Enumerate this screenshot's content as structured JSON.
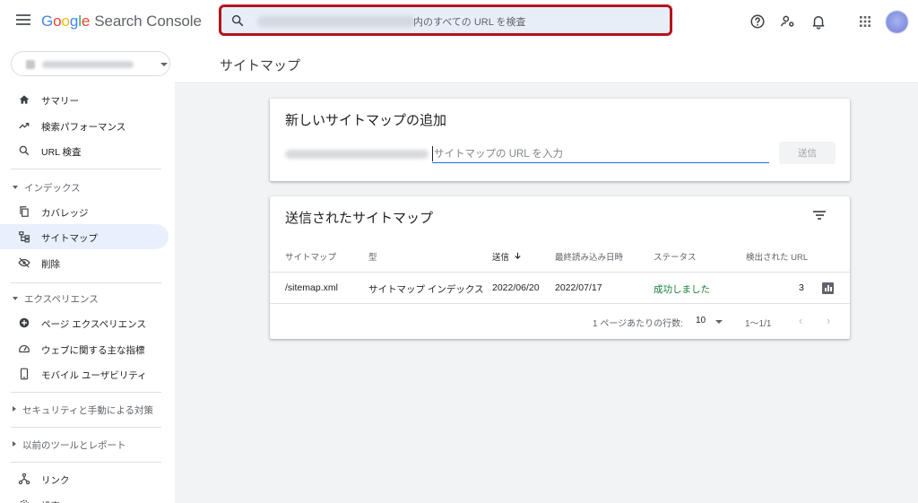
{
  "header": {
    "product_google": [
      "G",
      "o",
      "o",
      "g",
      "l",
      "e"
    ],
    "product_name": "Search Console",
    "search_placeholder": "内のすべての URL を検査"
  },
  "sidebar": {
    "items_top": [
      {
        "label": "サマリー",
        "icon": "home-icon"
      },
      {
        "label": "検索パフォーマンス",
        "icon": "trending-up-icon"
      },
      {
        "label": "URL 検査",
        "icon": "search-icon"
      }
    ],
    "index_section": "インデックス",
    "index_items": [
      {
        "label": "カバレッジ",
        "icon": "file-copy-icon"
      },
      {
        "label": "サイトマップ",
        "icon": "sitemap-icon"
      },
      {
        "label": "削除",
        "icon": "visibility-off-icon"
      }
    ],
    "experience_section": "エクスペリエンス",
    "experience_items": [
      {
        "label": "ページ エクスペリエンス",
        "icon": "add-circle-icon"
      },
      {
        "label": "ウェブに関する主な指標",
        "icon": "speed-icon"
      },
      {
        "label": "モバイル ユーザビリティ",
        "icon": "smartphone-icon"
      }
    ],
    "security_section": "セキュリティと手動による対策",
    "legacy_section": "以前のツールとレポート",
    "bottom_items": [
      {
        "label": "リンク",
        "icon": "links-icon"
      },
      {
        "label": "設定",
        "icon": "settings-icon"
      }
    ]
  },
  "page": {
    "title": "サイトマップ"
  },
  "add_sitemap": {
    "title": "新しいサイトマップの追加",
    "input_placeholder": "サイトマップの URL を入力",
    "submit_label": "送信"
  },
  "submitted": {
    "title": "送信されたサイトマップ",
    "columns": [
      "サイトマップ",
      "型",
      "送信",
      "最終読み込み日時",
      "ステータス",
      "検出された URL"
    ],
    "rows": [
      {
        "sitemap": "/sitemap.xml",
        "type": "サイトマップ インデックス",
        "submitted": "2022/06/20",
        "last_read": "2022/07/17",
        "status": "成功しました",
        "urls": "3"
      }
    ],
    "rows_per_page_label": "1 ページあたりの行数:",
    "rows_per_page_value": "10",
    "range": "1〜1/1"
  },
  "colors": {
    "accent": "#1a73e8",
    "highlight_border": "#b3151c",
    "status_ok": "#188038",
    "active_nav": "#e8f0fe"
  }
}
